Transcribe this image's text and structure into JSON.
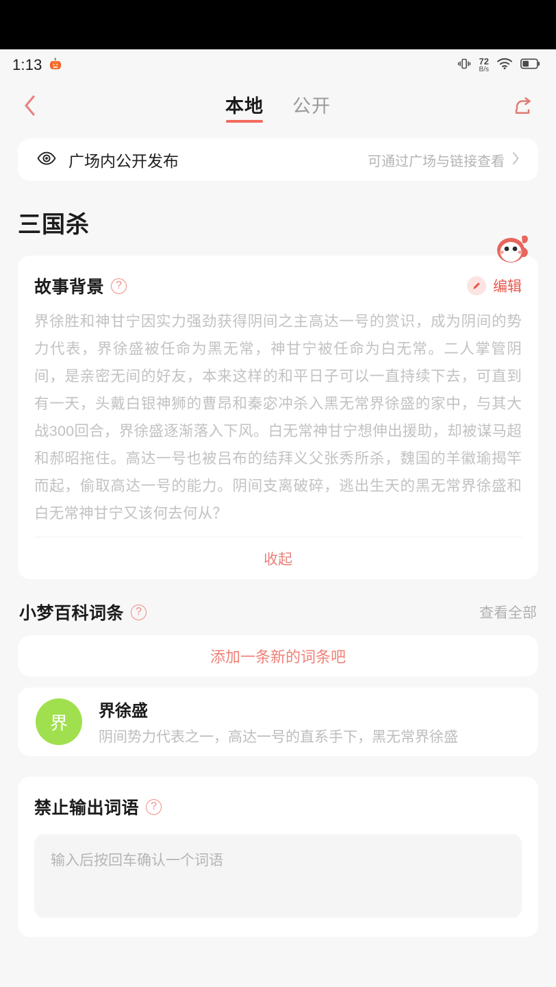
{
  "status_bar": {
    "time": "1:13",
    "pumpkin_icon": "pumpkin-emoji",
    "vibrate_icon": "vibrate-icon",
    "net_speed_value": "72",
    "net_speed_unit": "B/s",
    "wifi_icon": "wifi-icon",
    "battery_icon": "battery-icon"
  },
  "nav": {
    "back_icon": "chevron-left-icon",
    "share_icon": "share-icon",
    "tabs": [
      {
        "label": "本地",
        "active": true
      },
      {
        "label": "公开",
        "active": false
      }
    ]
  },
  "visibility": {
    "eye_icon": "eye-icon",
    "label": "广场内公开发布",
    "hint": "可通过广场与链接查看",
    "chevron_icon": "chevron-right-icon"
  },
  "page_title": "三国杀",
  "mascot": "mascot-icon",
  "story": {
    "title": "故事背景",
    "help_icon": "question-mark-icon",
    "edit_icon": "pencil-icon",
    "edit_label": "编辑",
    "body": "界徐胜和神甘宁因实力强劲获得阴间之主高达一号的赏识，成为阴间的势力代表，界徐盛被任命为黑无常，神甘宁被任命为白无常。二人掌管阴间，是亲密无间的好友，本来这样的和平日子可以一直持续下去，可直到有一天，头戴白银神狮的曹昂和秦宓冲杀入黑无常界徐盛的家中，与其大战300回合，界徐盛逐渐落入下风。白无常神甘宁想伸出援助，却被谋马超和郝昭拖住。高达一号也被吕布的结拜义父张秀所杀，魏国的羊徽瑜揭竿而起，偷取高达一号的能力。阴间支离破碎，逃出生天的黑无常界徐盛和白无常神甘宁又该何去何从？",
    "collapse_label": "收起"
  },
  "encyclopedia": {
    "title": "小梦百科词条",
    "help_icon": "question-mark-icon",
    "view_all_label": "查看全部",
    "add_label": "添加一条新的词条吧",
    "entries": [
      {
        "avatar_char": "界",
        "avatar_color": "#a0e04e",
        "name": "界徐盛",
        "desc": "阴间势力代表之一，高达一号的直系手下，黑无常界徐盛"
      }
    ]
  },
  "forbidden": {
    "title": "禁止输出词语",
    "help_icon": "question-mark-icon",
    "placeholder": "输入后按回车确认一个词语",
    "value": ""
  },
  "colors": {
    "accent": "#e8574c",
    "accent_soft": "#ef8b82",
    "page_bg": "#f7f7f7",
    "card_bg": "#ffffff",
    "avatar_green": "#a0e04e"
  }
}
